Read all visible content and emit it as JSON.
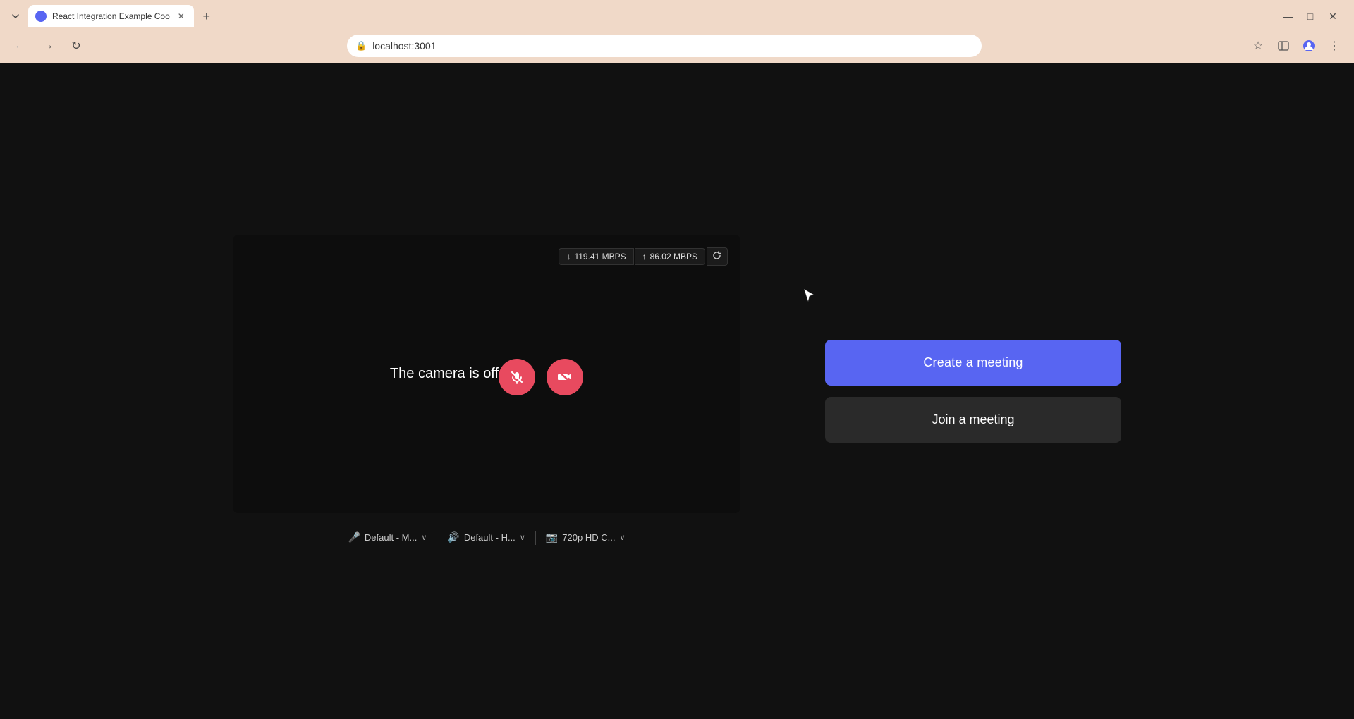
{
  "browser": {
    "tab": {
      "title": "React Integration Example Coo",
      "favicon": "R"
    },
    "new_tab_label": "+",
    "address": "localhost:3001",
    "window_controls": {
      "minimize": "—",
      "maximize": "□",
      "close": "✕"
    },
    "nav": {
      "back": "←",
      "forward": "→",
      "reload": "↻"
    }
  },
  "video": {
    "camera_off_text": "The camera is off",
    "network": {
      "download_icon": "↓",
      "download_value": "119.41 MBPS",
      "upload_icon": "↑",
      "upload_value": "86.02 MBPS",
      "refresh_icon": "↻"
    },
    "controls": {
      "mute_label": "mute",
      "camera_off_label": "camera-off"
    },
    "devices": {
      "mic": {
        "icon": "🎤",
        "label": "Default - M...",
        "chevron": "∨"
      },
      "speaker": {
        "icon": "🔊",
        "label": "Default - H...",
        "chevron": "∨"
      },
      "camera": {
        "icon": "📷",
        "label": "720p HD C...",
        "chevron": "∨"
      }
    }
  },
  "actions": {
    "create_meeting": "Create a meeting",
    "join_meeting": "Join a meeting"
  },
  "colors": {
    "create_btn_bg": "#5865f2",
    "join_btn_bg": "#2a2a2a",
    "mute_btn_bg": "#e84a5f"
  }
}
